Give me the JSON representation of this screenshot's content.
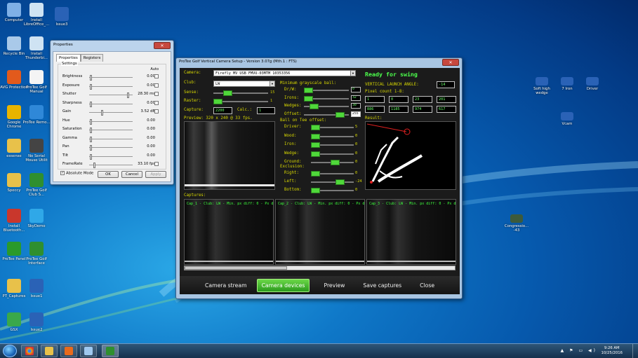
{
  "desktop": {
    "left_icons": [
      {
        "label": "Computer",
        "icon": "computer-icon",
        "color": "#7fb0e6"
      },
      {
        "label": "Install LibreOffice_...",
        "icon": "libreoffice-install-icon",
        "color": "#cfe3f3"
      },
      {
        "label": "Issue3",
        "icon": "video-shortcut-icon",
        "color": "#2a62b6"
      },
      {
        "label": "Recycle Bin",
        "icon": "recycle-bin-icon",
        "color": "#a9c9e9"
      },
      {
        "label": "Install Thunderbi...",
        "icon": "thunderbird-install-icon",
        "color": "#cfe3f3"
      },
      {
        "label": "AVG Protection",
        "icon": "avg-icon",
        "color": "#e25a1c"
      },
      {
        "label": "ProTee Golf Manual",
        "icon": "pdf-document-icon",
        "color": "#f4f4f4"
      },
      {
        "label": "Google Chrome",
        "icon": "chrome-icon",
        "color": "#e8b400"
      },
      {
        "label": "ProTee Remo...",
        "icon": "protee-remote-icon",
        "color": "#2f88d8"
      },
      {
        "label": "essense",
        "icon": "folder-icon",
        "color": "#e8c14a"
      },
      {
        "label": "No Serial Mouse Utilit",
        "icon": "gear-utility-icon",
        "color": "#444"
      },
      {
        "label": "Speccy",
        "icon": "folder-icon",
        "color": "#e8c14a"
      },
      {
        "label": "ProTee Golf Club S...",
        "icon": "golfer-icon",
        "color": "#2f8f2f"
      },
      {
        "label": "Install Bluetooth...",
        "icon": "bluetooth-install-icon",
        "color": "#c9372c"
      },
      {
        "label": "SkyDemo",
        "icon": "skytrak-icon",
        "color": "#2fa8e8"
      },
      {
        "label": "ProTee Panel",
        "icon": "protee-panel-icon",
        "color": "#2a9a2a"
      },
      {
        "label": "ProTee Golf Interface",
        "icon": "golfer-icon",
        "color": "#2f8f2f"
      },
      {
        "label": "PT_Captures",
        "icon": "folder-icon",
        "color": "#e8c14a"
      },
      {
        "label": "Issue1",
        "icon": "video-shortcut-icon",
        "color": "#2a62b6"
      },
      {
        "label": "GSX",
        "icon": "gsx-icon",
        "color": "#3aa84a"
      },
      {
        "label": "Issue2",
        "icon": "video-shortcut-icon",
        "color": "#2a62b6"
      }
    ],
    "right_icons": [
      {
        "label": "Soft high wedge",
        "icon": "video-shortcut-icon",
        "color": "#2a62b6"
      },
      {
        "label": "7 Iron",
        "icon": "video-shortcut-icon",
        "color": "#2a62b6"
      },
      {
        "label": "Driver",
        "icon": "video-shortcut-icon",
        "color": "#2a62b6"
      },
      {
        "label": "Vcam",
        "icon": "video-shortcut-icon",
        "color": "#2a62b6"
      },
      {
        "label": "Congressio... -43",
        "icon": "board-icon",
        "color": "#3c5a3c"
      }
    ]
  },
  "properties": {
    "title": "Properties",
    "close": "✕",
    "tabs": [
      "Properties",
      "Registers"
    ],
    "group_label": "Settings",
    "auto_label": "Auto",
    "rows": [
      {
        "name": "Brightness",
        "value": "0.00",
        "pos": 0.02,
        "auto": true
      },
      {
        "name": "Exposure",
        "value": "0.00",
        "pos": 0.02,
        "auto": true
      },
      {
        "name": "Shutter",
        "value": "28.30 ms",
        "pos": 0.92,
        "auto": true
      },
      {
        "name": "Sharpness",
        "value": "0.00",
        "pos": 0.02,
        "auto": true
      },
      {
        "name": "Gain",
        "value": "3.52 dB",
        "pos": 0.28,
        "auto": true
      },
      {
        "name": "Hue",
        "value": "0.00",
        "pos": 0.02,
        "auto": false
      },
      {
        "name": "Saturation",
        "value": "0.00",
        "pos": 0.02,
        "auto": false
      },
      {
        "name": "Gamma",
        "value": "0.00",
        "pos": 0.02,
        "auto": false
      },
      {
        "name": "Pan",
        "value": "0.00",
        "pos": 0.02,
        "auto": false
      },
      {
        "name": "Tilt",
        "value": "0.00",
        "pos": 0.02,
        "auto": false
      },
      {
        "name": "FrameRate",
        "value": "33.10 fps",
        "pos": 0.1,
        "auto": true
      }
    ],
    "absolute_mode": "Absolute Mode",
    "buttons": {
      "ok": "OK",
      "cancel": "Cancel",
      "apply": "Apply"
    }
  },
  "protee": {
    "title": "ProTee Golf Vertical Camera Setup - Version 3.07g (Mth.1 : FTS)",
    "close": "✕",
    "camera_label": "Camera:",
    "camera_value": "Firefly MV USB FMVU-03MTM 10353356",
    "club_label": "Club:",
    "club_value": "LW",
    "sense_label": "Sense:",
    "sense_value": "15",
    "raster_label": "Raster:",
    "raster_value": "1",
    "capture_label": "Capture:",
    "capture_value": "2200",
    "calc_label": "Calc.:",
    "calc_value": "1",
    "preview_label": "Preview: 320 x 240 @ 33 fps.",
    "min_gray_label": "Minimum grayscale ball:",
    "gray": [
      {
        "label": "Dr/W:",
        "value": "0"
      },
      {
        "label": "Irons:",
        "value": "32"
      },
      {
        "label": "Wedges:",
        "value": "30"
      },
      {
        "label": "Offset:",
        "value": "255"
      }
    ],
    "tee_label": "Ball on Tee offset:",
    "tee": [
      {
        "label": "Driver:",
        "value": "5"
      },
      {
        "label": "Wood:",
        "value": "0"
      },
      {
        "label": "Iron:",
        "value": "0"
      },
      {
        "label": "Wedge:",
        "value": "0"
      },
      {
        "label": "Ground:",
        "value": "0"
      }
    ],
    "exclusion_label": "Exclusion:",
    "exclusion": [
      {
        "label": "Right:",
        "value": "0"
      },
      {
        "label": "Left:",
        "value": "-24"
      },
      {
        "label": "Bottom:",
        "value": "0"
      }
    ],
    "status": "Ready for swing",
    "vla_label": "VERTICAL LAUNCH ANGLE:",
    "vla_value": "-14",
    "pixel_label": "Pixel count 1-8:",
    "pixels": [
      "1",
      "0",
      "23",
      "201",
      "886",
      "1185",
      "974",
      "617"
    ],
    "result_label": "Result:",
    "captures_label": "Captures:",
    "captures": [
      "Cap_1 - Club: LW - Min. px diff: 0 - Px diff: 1",
      "Cap_2 - Club: LW - Min. px diff: 0 - Px diff: 4",
      "Cap_3 - Club: LW - Min. px diff: 0 - Px diff: 23"
    ],
    "toolbar": [
      "Camera stream",
      "Camera devices",
      "Preview",
      "Save captures",
      "Close"
    ]
  },
  "taskbar": {
    "time": "9:26 AM",
    "date": "10/25/2016",
    "tray": "▲ ⚑ ▭ ◀)"
  },
  "colors": {
    "accent_green": "#4fd83a",
    "label_yellow": "#d8d800",
    "status_green": "#4cff4c"
  }
}
